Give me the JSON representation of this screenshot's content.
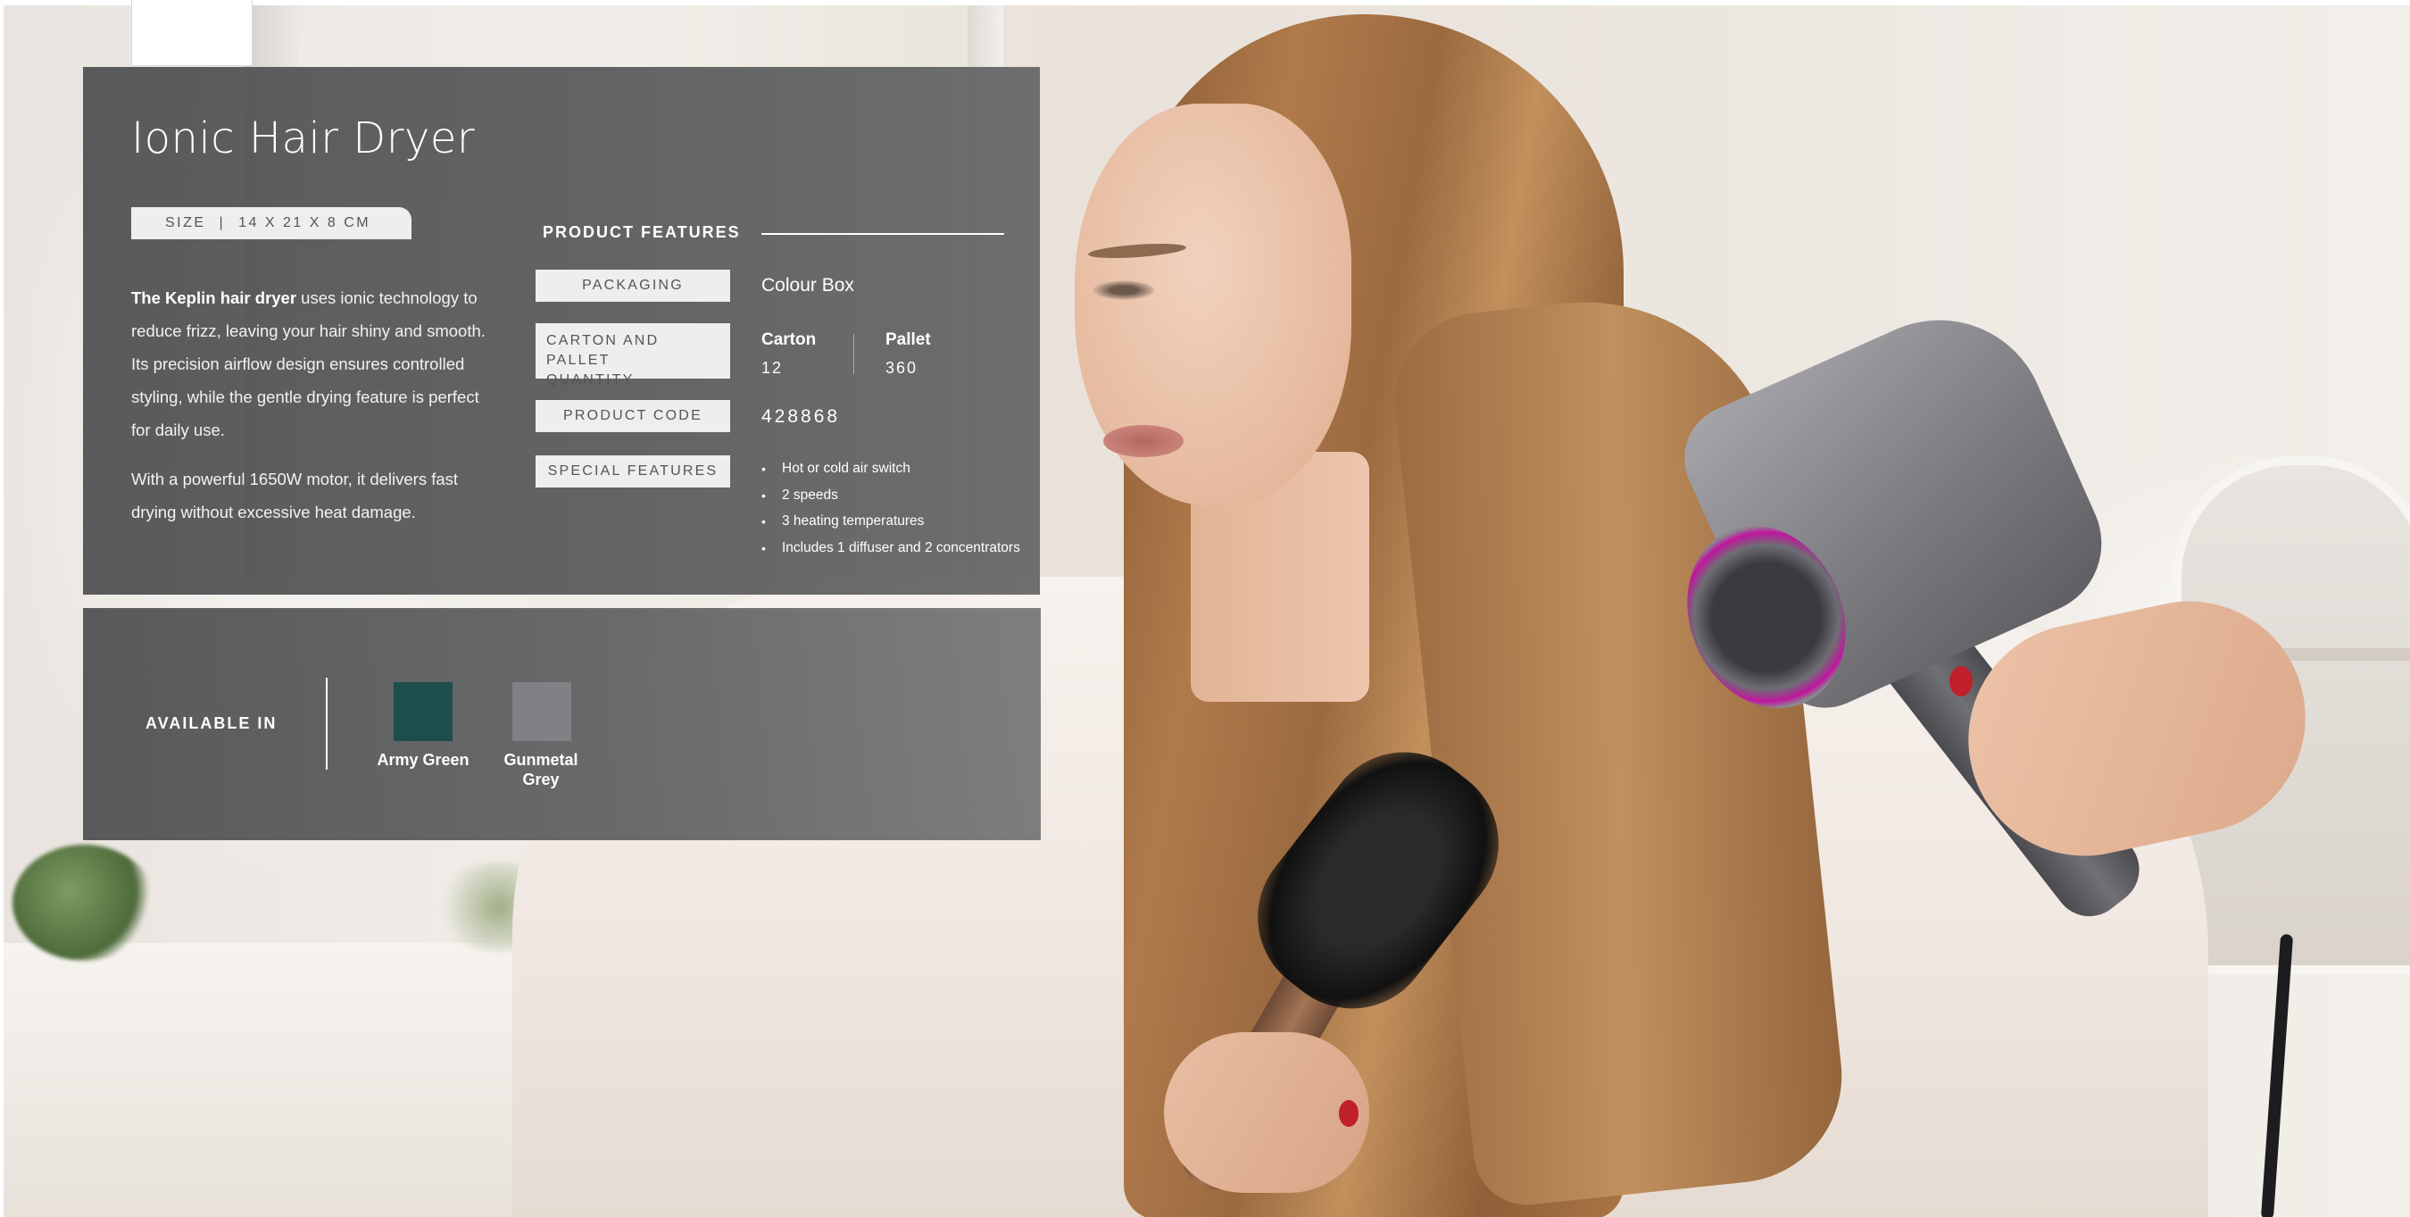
{
  "product": {
    "title": "Ionic Hair Dryer",
    "size_label": "SIZE",
    "size_separator": "|",
    "size_value": "14 X 21 X 8 CM",
    "description_bold": "The Keplin hair dryer",
    "description_rest": " uses ionic technology to reduce frizz, leaving your hair shiny and smooth. Its precision airflow design ensures controlled styling, while the gentle drying feature is perfect for daily use.",
    "description_2": "With a powerful 1650W motor, it delivers fast drying without excessive heat damage."
  },
  "features": {
    "heading": "PRODUCT FEATURES",
    "packaging_label": "PACKAGING",
    "packaging_value": "Colour Box",
    "carton_label_line1": "CARTON AND PALLET",
    "carton_label_line2": "QUANTITY",
    "carton_heading": "Carton",
    "carton_value": "12",
    "pallet_heading": "Pallet",
    "pallet_value": "360",
    "code_label": "PRODUCT CODE",
    "code_value": "428868",
    "special_label": "SPECIAL FEATURES",
    "special_items": [
      "Hot or cold air switch",
      "2 speeds",
      "3 heating temperatures",
      "Includes 1 diffuser and 2 concentrators"
    ]
  },
  "availability": {
    "label": "AVAILABLE IN",
    "colors": [
      {
        "name": "Army Green",
        "hex": "#1d4d4c"
      },
      {
        "name_line1": "Gunmetal",
        "name_line2": "Grey",
        "hex": "#808085"
      }
    ]
  }
}
